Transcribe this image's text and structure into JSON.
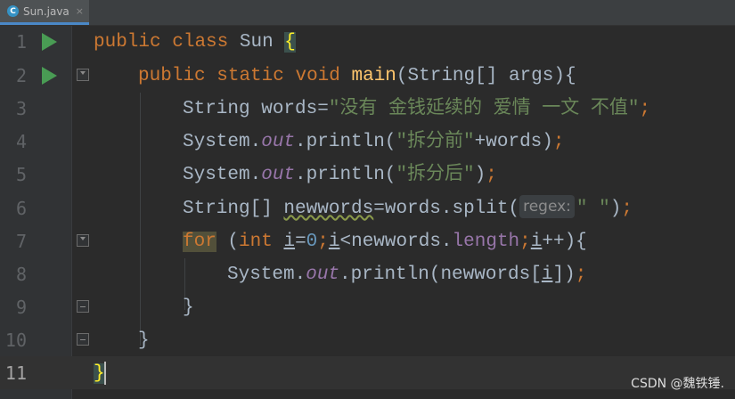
{
  "tab": {
    "label": "Sun.java",
    "close": "×",
    "icon": "c-class-icon"
  },
  "lines": [
    {
      "n": "1"
    },
    {
      "n": "2"
    },
    {
      "n": "3"
    },
    {
      "n": "4"
    },
    {
      "n": "5"
    },
    {
      "n": "6"
    },
    {
      "n": "7"
    },
    {
      "n": "8"
    },
    {
      "n": "9"
    },
    {
      "n": "10"
    },
    {
      "n": "11"
    }
  ],
  "code": {
    "l1": {
      "kw1": "public",
      "kw2": "class",
      "name": "Sun",
      "brace": "{"
    },
    "l2": {
      "kw1": "public",
      "kw2": "static",
      "kw3": "void",
      "fn": "main",
      "params": "(String[] args){"
    },
    "l3": {
      "a": "String words=",
      "s": "\"没有 金钱延续的 爱情 一文 不值\"",
      "semi": ";"
    },
    "l4": {
      "a": "System.",
      "f": "out",
      "b": ".println(",
      "s": "\"拆分前\"",
      "c": "+words)",
      "semi": ";"
    },
    "l5": {
      "a": "System.",
      "f": "out",
      "b": ".println(",
      "s": "\"拆分后\"",
      "c": ")",
      "semi": ";"
    },
    "l6": {
      "a": "String[] ",
      "v": "newwords",
      "b": "=words.split(",
      "hint": "regex:",
      "s": "\" \"",
      "c": ")",
      "semi": ";"
    },
    "l7": {
      "kw": "for",
      "a": " (",
      "kw2": "int",
      "b": " ",
      "i1": "i",
      "c": "=",
      "num": "0",
      "semi1": ";",
      "i2": "i",
      "d": "<newwords.",
      "len": "length",
      "semi2": ";",
      "i3": "i",
      "e": "++){"
    },
    "l8": {
      "a": "System.",
      "f": "out",
      "b": ".println(newwords[",
      "i": "i",
      "c": "])",
      "semi": ";"
    },
    "l9": {
      "a": "}"
    },
    "l10": {
      "a": "}"
    },
    "l11": {
      "a": "}"
    }
  },
  "watermark": "CSDN @魏铁锤."
}
